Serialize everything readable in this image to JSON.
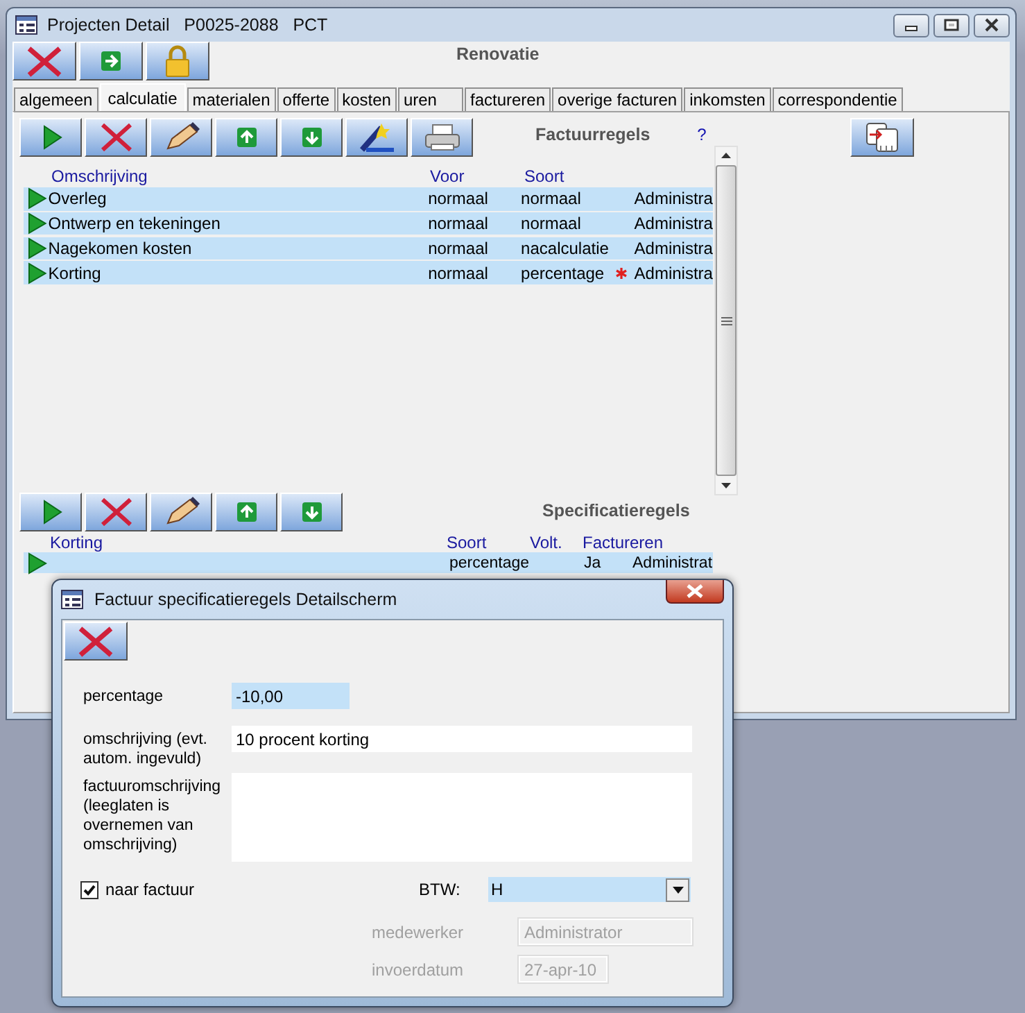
{
  "window": {
    "title": "Projecten Detail   P0025-2088   PCT"
  },
  "toolbar": [
    {
      "kind": "delete"
    },
    {
      "kind": "next"
    },
    {
      "kind": "lock"
    }
  ],
  "project_name": "Renovatie",
  "tabs": [
    {
      "label": "algemeen",
      "selected": false
    },
    {
      "label": "calculatie",
      "selected": true
    },
    {
      "label": "materialen",
      "selected": false
    },
    {
      "label": "offerte",
      "selected": false
    },
    {
      "label": "kosten",
      "selected": false
    },
    {
      "label": "uren",
      "selected": false
    },
    {
      "label": "factureren",
      "selected": false
    },
    {
      "label": "overige facturen",
      "selected": false
    },
    {
      "label": "inkomsten",
      "selected": false
    },
    {
      "label": "correspondentie",
      "selected": false
    }
  ],
  "factuurregels": {
    "title": "Factuurregels",
    "help": "?",
    "toolbar": [
      {
        "kind": "play"
      },
      {
        "kind": "delete"
      },
      {
        "kind": "edit"
      },
      {
        "kind": "up"
      },
      {
        "kind": "down"
      },
      {
        "kind": "wizard"
      },
      {
        "kind": "print"
      }
    ],
    "columns": [
      "Omschrijving",
      "Voor",
      "Soort"
    ],
    "rows": [
      {
        "omschrijving": "Overleg",
        "voor": "normaal",
        "soort": "normaal",
        "flagged": false,
        "column_4": "Administra"
      },
      {
        "omschrijving": "Ontwerp en tekeningen",
        "voor": "normaal",
        "soort": "normaal",
        "flagged": false,
        "column_4": "Administra"
      },
      {
        "omschrijving": "Nagekomen kosten",
        "voor": "normaal",
        "soort": "nacalculatie",
        "flagged": false,
        "column_4": "Administra"
      },
      {
        "omschrijving": "Korting",
        "voor": "normaal",
        "soort": "percentage",
        "flagged": true,
        "column_4": "Administra"
      }
    ]
  },
  "specificatieregels": {
    "title": "Specificatieregels",
    "toolbar": [
      {
        "kind": "play"
      },
      {
        "kind": "delete"
      },
      {
        "kind": "edit"
      },
      {
        "kind": "up"
      },
      {
        "kind": "down"
      }
    ],
    "columns": [
      "Korting",
      "Soort",
      "Volt.",
      "Factureren"
    ],
    "rows": [
      {
        "soort": "percentage",
        "factureren": "Ja",
        "column_5": "Administrat"
      }
    ]
  },
  "dialog": {
    "title": "Factuur specificatieregels Detailscherm",
    "toolbar": [
      {
        "kind": "delete"
      }
    ],
    "percentage": {
      "label": "percentage",
      "value": "-10,00"
    },
    "omschrijving": {
      "label": "omschrijving (evt. autom. ingevuld)",
      "value": "10 procent korting"
    },
    "factuuromschrijving": {
      "label": "factuuromschrijving (leeglaten is overnemen van omschrijving)"
    },
    "naar_factuur": {
      "label": "naar factuur",
      "checked": true
    },
    "btw": {
      "label": "BTW:",
      "value": "H"
    },
    "medewerker": {
      "label": "medewerker",
      "value": "Administrator",
      "disabled": true
    },
    "invoerdatum": {
      "label": "invoerdatum",
      "value": "27-apr-10",
      "disabled": true
    }
  }
}
